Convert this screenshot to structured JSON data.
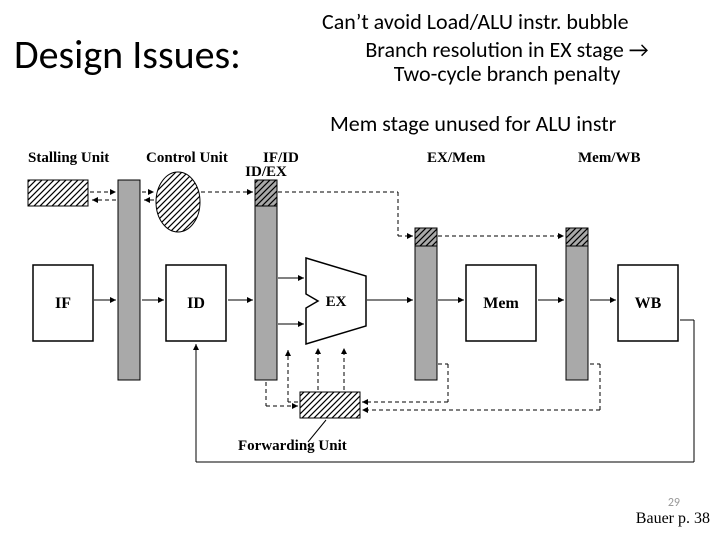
{
  "title": "Design Issues:",
  "bullets": {
    "b1": "Can’t avoid Load/ALU instr. bubble",
    "b2": "Branch resolution in EX stage → Two-cycle branch penalty",
    "b3": "Mem stage unused for ALU instr"
  },
  "diagram": {
    "stalling_unit": "Stalling Unit",
    "control_unit": "Control Unit",
    "if_id": "IF/ID",
    "id_ex": "ID/EX",
    "ex_mem": "EX/Mem",
    "mem_wb": "Mem/WB",
    "if": "IF",
    "id": "ID",
    "ex": "EX",
    "mem": "Mem",
    "wb": "WB",
    "forwarding_unit": "Forwarding Unit"
  },
  "page_number": "29",
  "citation": "Bauer p. 38"
}
